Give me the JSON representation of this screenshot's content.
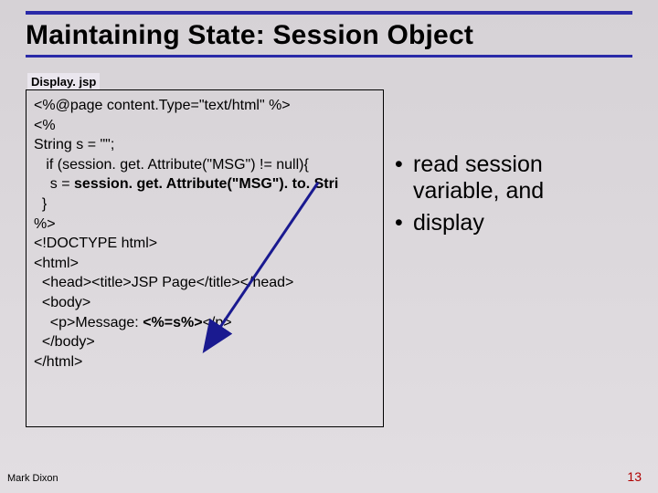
{
  "title": "Maintaining State: Session Object",
  "filename": "Display. jsp",
  "code": {
    "l1": "<%@page content.Type=\"text/html\" %>",
    "l2": "<%",
    "l3": "String s = \"\";",
    "l4": "   if (session. get. Attribute(\"MSG\") != null){",
    "l5a": "    s = ",
    "l5b": "session. get. Attribute(\"MSG\"). to. Stri",
    "l6": "  }",
    "l7": "%>",
    "l8": "",
    "l9": "<!DOCTYPE html>",
    "l10": "<html>",
    "l11": "  <head><title>JSP Page</title></head>",
    "l12": "  <body>",
    "l13a": "    <p>Message: ",
    "l13b": "<%=s%>",
    "l13c": "</p>",
    "l14": "  </body>",
    "l15": "</html>"
  },
  "bullets": {
    "b1": "read session variable, and",
    "b2": "display"
  },
  "footer": {
    "author": "Mark Dixon",
    "page": "13"
  }
}
